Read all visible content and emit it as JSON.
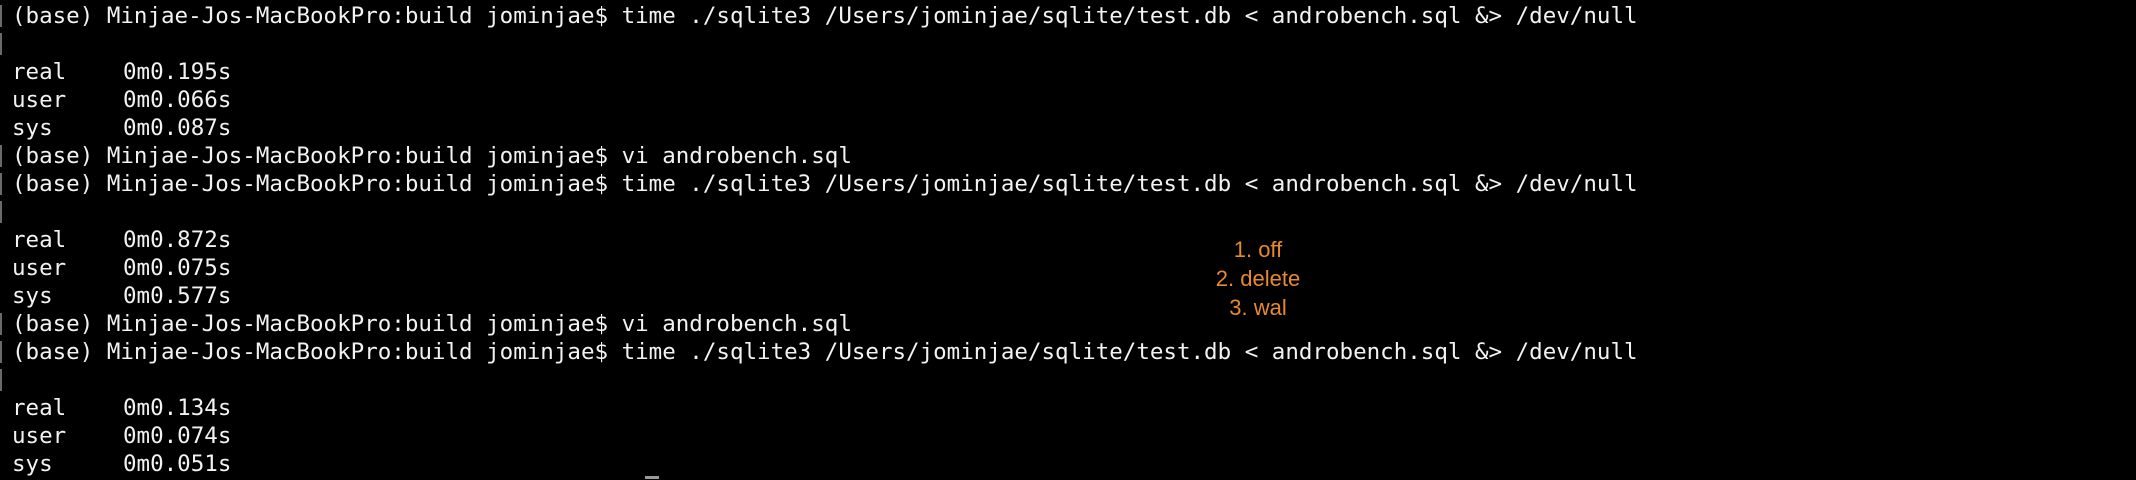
{
  "terminal": {
    "lines": [
      {
        "type": "prompt",
        "text": "(base) Minjae-Jos-MacBookPro:build jominjae$ time ./sqlite3 /Users/jominjae/sqlite/test.db < androbench.sql &> /dev/null"
      },
      {
        "type": "blank",
        "text": ""
      },
      {
        "type": "timing",
        "label": "real",
        "value": "0m0.195s"
      },
      {
        "type": "timing",
        "label": "user",
        "value": "0m0.066s"
      },
      {
        "type": "timing",
        "label": "sys",
        "value": "0m0.087s"
      },
      {
        "type": "prompt",
        "text": "(base) Minjae-Jos-MacBookPro:build jominjae$ vi androbench.sql"
      },
      {
        "type": "prompt",
        "text": "(base) Minjae-Jos-MacBookPro:build jominjae$ time ./sqlite3 /Users/jominjae/sqlite/test.db < androbench.sql &> /dev/null"
      },
      {
        "type": "blank",
        "text": ""
      },
      {
        "type": "timing",
        "label": "real",
        "value": "0m0.872s"
      },
      {
        "type": "timing",
        "label": "user",
        "value": "0m0.075s"
      },
      {
        "type": "timing",
        "label": "sys",
        "value": "0m0.577s"
      },
      {
        "type": "prompt",
        "text": "(base) Minjae-Jos-MacBookPro:build jominjae$ vi androbench.sql"
      },
      {
        "type": "prompt",
        "text": "(base) Minjae-Jos-MacBookPro:build jominjae$ time ./sqlite3 /Users/jominjae/sqlite/test.db < androbench.sql &> /dev/null"
      },
      {
        "type": "blank",
        "text": ""
      },
      {
        "type": "timing",
        "label": "real",
        "value": "0m0.134s"
      },
      {
        "type": "timing",
        "label": "user",
        "value": "0m0.074s"
      },
      {
        "type": "timing",
        "label": "sys",
        "value": "0m0.051s"
      }
    ]
  },
  "annotation": {
    "items": [
      "1. off",
      "2. delete",
      "3. wal"
    ],
    "color": "#e8892f"
  },
  "colors": {
    "background": "#000000",
    "foreground": "#f2f2f2"
  }
}
